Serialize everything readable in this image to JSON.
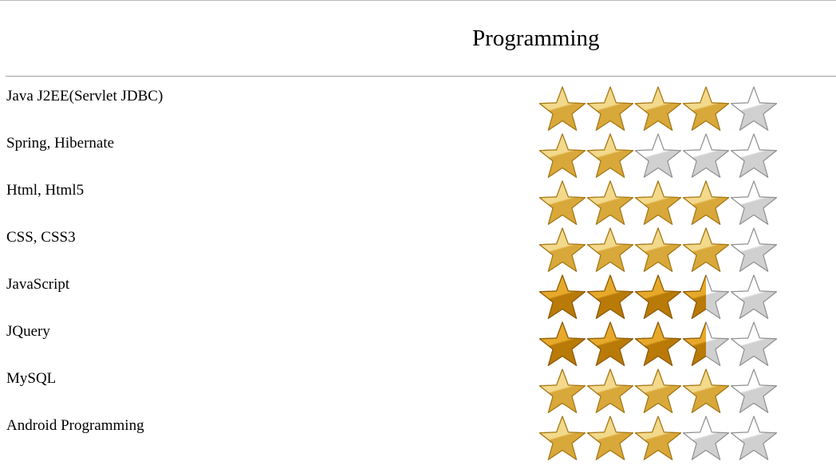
{
  "section": {
    "title": "Programming"
  },
  "rating_scale_max": 5,
  "colors": {
    "gold_light": "#f3d98b",
    "gold_mid": "#d9a83a",
    "gold_edge": "#a7780f",
    "bronze_light": "#e7a92a",
    "bronze_mid": "#b97a08",
    "bronze_edge": "#8d5a00",
    "empty_light": "#ffffff",
    "empty_mid": "#d0d0d0",
    "empty_edge": "#8f8f8f"
  },
  "skills": [
    {
      "name": "Java J2EE(Servlet JDBC)",
      "rating": 4,
      "style": "gold"
    },
    {
      "name": "Spring, Hibernate",
      "rating": 2,
      "style": "gold"
    },
    {
      "name": "Html, Html5",
      "rating": 4,
      "style": "gold"
    },
    {
      "name": "CSS, CSS3",
      "rating": 4,
      "style": "gold"
    },
    {
      "name": "JavaScript",
      "rating": 3.5,
      "style": "bronze"
    },
    {
      "name": "JQuery",
      "rating": 3.5,
      "style": "bronze"
    },
    {
      "name": "MySQL",
      "rating": 4,
      "style": "gold"
    },
    {
      "name": "Android Programming",
      "rating": 3,
      "style": "gold"
    }
  ]
}
